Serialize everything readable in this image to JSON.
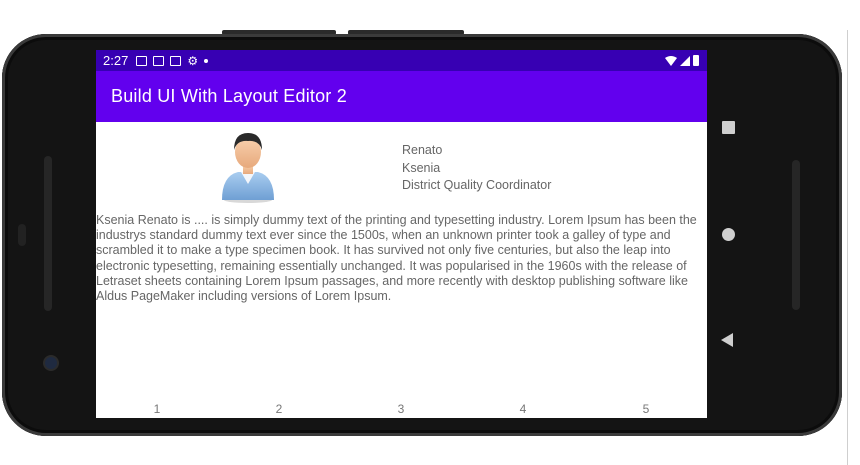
{
  "status_bar": {
    "time": "2:27",
    "left_icons": [
      "calendar-icon",
      "text-a-icon",
      "gmail-icon",
      "gear-icon",
      "dot-icon"
    ],
    "right_icons": [
      "wifi-icon",
      "signal-icon",
      "battery-icon"
    ]
  },
  "app_bar": {
    "title": "Build UI With Layout Editor 2"
  },
  "profile": {
    "avatar_icon": "user-avatar-icon",
    "first_name": "Renato",
    "last_name": "Ksenia",
    "job_title": "District Quality Coordinator"
  },
  "description": "Ksenia Renato is .... is simply dummy text of the printing and typesetting industry. Lorem Ipsum has been the industrys standard dummy text ever since the 1500s, when an unknown printer took a galley of type and scrambled it to make a type specimen book. It has survived not only five centuries, but also the leap into electronic typesetting, remaining essentially unchanged. It was popularised in the 1960s with the release of Letraset sheets containing Lorem Ipsum passages, and more recently with desktop publishing software like Aldus PageMaker including versions of Lorem Ipsum.",
  "tabs": [
    "1",
    "2",
    "3",
    "4",
    "5"
  ],
  "nav_buttons": [
    "overview-square-icon",
    "home-circle-icon",
    "back-triangle-icon"
  ],
  "colors": {
    "status_bar": "#3700b3",
    "app_bar": "#6200ee",
    "text": "#666666"
  }
}
